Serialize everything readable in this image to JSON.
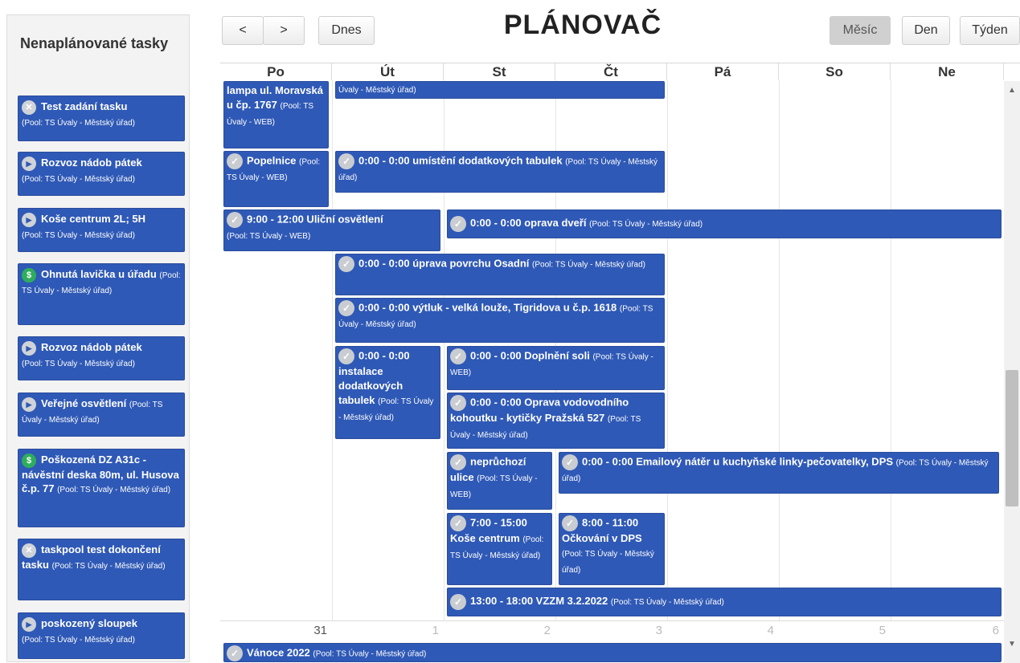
{
  "title": "PLÁNOVAČ",
  "toolbar": {
    "prev": "<",
    "next": ">",
    "today": "Dnes",
    "views": [
      "Měsíc",
      "Den",
      "Týden"
    ]
  },
  "sidebar": {
    "title": "Nenaplánované tasky",
    "items": [
      {
        "icon": "x",
        "title": "Test zadání tasku",
        "pool": "(Pool: TS Úvaly - Městský úřad)"
      },
      {
        "icon": "play",
        "title": "Rozvoz nádob pátek",
        "pool": "(Pool: TS Úvaly - Městský úřad)"
      },
      {
        "icon": "play",
        "title": "Koše centrum 2L; 5H",
        "pool": "(Pool: TS Úvaly - Městský úřad)"
      },
      {
        "icon": "dollar",
        "title": "Ohnutá lavička u úřadu",
        "pool": "(Pool: TS Úvaly - Městský úřad)"
      },
      {
        "icon": "play",
        "title": "Rozvoz nádob pátek",
        "pool": "(Pool: TS Úvaly - Městský úřad)"
      },
      {
        "icon": "play",
        "title": "Veřejné osvětlení",
        "pool": "(Pool: TS Úvaly - Městský úřad)"
      },
      {
        "icon": "dollar",
        "title": "Poškozená DZ A31c - návěstní deska 80m, ul. Husova č.p. 77",
        "pool": "(Pool: TS Úvaly - Městský úřad)"
      },
      {
        "icon": "x",
        "title": "taskpool test dokončení tasku",
        "pool": "(Pool: TS Úvaly - Městský úřad)"
      },
      {
        "icon": "play",
        "title": "poskozený sloupek",
        "pool": "(Pool: TS Úvaly - Městský úřad)"
      }
    ]
  },
  "calendar": {
    "days": [
      "Po",
      "Út",
      "St",
      "Čt",
      "Pá",
      "So",
      "Ne"
    ],
    "dates": [
      "31",
      "1",
      "2",
      "3",
      "4",
      "5",
      "6"
    ],
    "events": [
      {
        "title": "lampa ul. Moravská u čp. 1767",
        "pool": "(Pool: TS Úvaly - WEB)",
        "check": false
      },
      {
        "title": "",
        "pool": "Úvaly - Městský úřad)",
        "check": false
      },
      {
        "title": "Popelnice",
        "pool": "(Pool: TS Úvaly - WEB)",
        "check": true
      },
      {
        "title": "0:00 - 0:00 umístění dodatkových tabulek",
        "pool": "(Pool: TS Úvaly - Městský úřad)",
        "check": true
      },
      {
        "title": "9:00 - 12:00 Uliční osvětlení",
        "pool": "(Pool: TS Úvaly - WEB)",
        "check": true
      },
      {
        "title": "0:00 - 0:00 oprava dveří",
        "pool": "(Pool: TS Úvaly - Městský úřad)",
        "check": true
      },
      {
        "title": "0:00 - 0:00 úprava povrchu Osadní",
        "pool": "(Pool: TS Úvaly - Městský úřad)",
        "check": true
      },
      {
        "title": "0:00 - 0:00 výtluk - velká louže, Tigridova u č.p. 1618",
        "pool": "(Pool: TS Úvaly - Městský úřad)",
        "check": true
      },
      {
        "title": "0:00 - 0:00 instalace dodatkových tabulek",
        "pool": "(Pool: TS Úvaly - Městský úřad)",
        "check": true
      },
      {
        "title": "0:00 - 0:00 Doplnění soli",
        "pool": "(Pool: TS Úvaly - WEB)",
        "check": true
      },
      {
        "title": "0:00 - 0:00 Oprava vodovodního kohoutku - kytičky Pražská 527",
        "pool": "(Pool: TS Úvaly - Městský úřad)",
        "check": true
      },
      {
        "title": "neprůchozí ulice",
        "pool": "(Pool: TS Úvaly - WEB)",
        "check": true
      },
      {
        "title": "0:00 - 0:00 Emailový nátěr u kuchyňské linky-pečovatelky, DPS",
        "pool": "(Pool: TS Úvaly - Městský úřad)",
        "check": true
      },
      {
        "title": "7:00 - 15:00 Koše centrum",
        "pool": "(Pool: TS Úvaly - Městský úřad)",
        "check": true
      },
      {
        "title": "8:00 - 11:00 Očkování v DPS",
        "pool": "(Pool: TS Úvaly - Městský úřad)",
        "check": true
      },
      {
        "title": "13:00 - 18:00 VZZM 3.2.2022",
        "pool": "(Pool: TS Úvaly - Městský úřad)",
        "check": true
      },
      {
        "title": "Vánoce 2022",
        "pool": "(Pool: TS Úvaly - Městský úřad)",
        "check": true
      }
    ]
  },
  "colors": {
    "event": "#2f59b6",
    "sidebar_bg": "#f3f3f3",
    "dollar": "#2eae5c"
  }
}
